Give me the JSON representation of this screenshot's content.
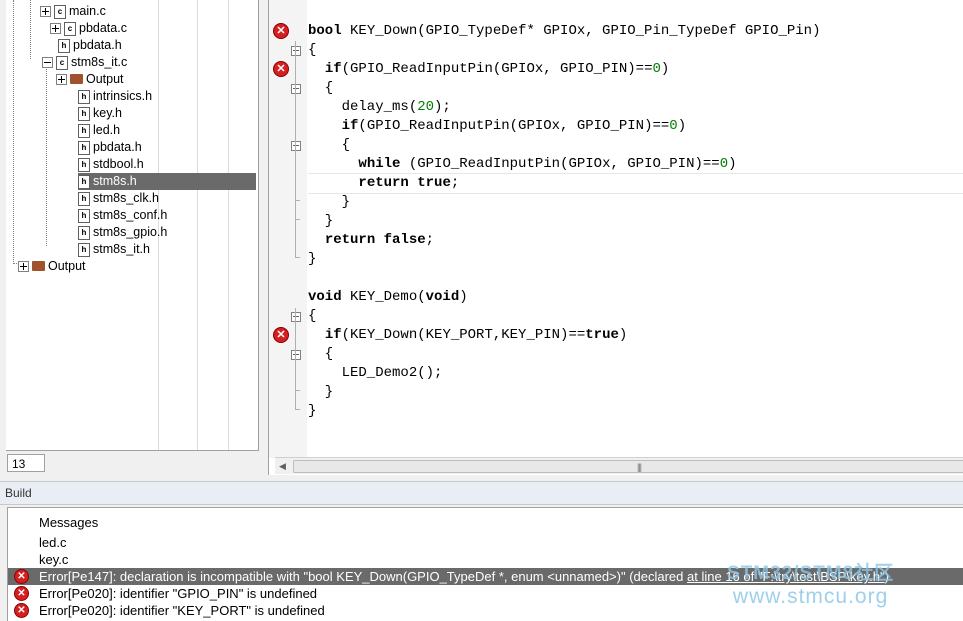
{
  "workspace": {
    "line_number": "13",
    "tree": [
      {
        "label": "main.c",
        "type": "c",
        "expander": "plus"
      },
      {
        "label": "pbdata.c",
        "type": "c",
        "expander": "plus"
      },
      {
        "label": "pbdata.h",
        "type": "h",
        "expander": ""
      },
      {
        "label": "stm8s_it.c",
        "type": "c",
        "expander": "minus"
      },
      {
        "label": "Output",
        "type": "folder",
        "expander": "plus"
      },
      {
        "label": "intrinsics.h",
        "type": "h",
        "expander": ""
      },
      {
        "label": "key.h",
        "type": "h",
        "expander": ""
      },
      {
        "label": "led.h",
        "type": "h",
        "expander": ""
      },
      {
        "label": "pbdata.h",
        "type": "h",
        "expander": ""
      },
      {
        "label": "stdbool.h",
        "type": "h",
        "expander": ""
      },
      {
        "label": "stm8s.h",
        "type": "h",
        "expander": "",
        "selected": true
      },
      {
        "label": "stm8s_clk.h",
        "type": "h",
        "expander": ""
      },
      {
        "label": "stm8s_conf.h",
        "type": "h",
        "expander": ""
      },
      {
        "label": "stm8s_gpio.h",
        "type": "h",
        "expander": ""
      },
      {
        "label": "stm8s_it.h",
        "type": "h",
        "expander": ""
      },
      {
        "label": "Output",
        "type": "folder",
        "expander": "plus"
      }
    ]
  },
  "editor": {
    "lines": [
      {
        "segments": [
          {
            "t": "bool",
            "c": "kw"
          },
          {
            "t": " KEY_Down(GPIO_TypeDef* GPIOx, GPIO_Pin_TypeDef GPIO_Pin)",
            "c": ""
          }
        ],
        "error": true
      },
      {
        "segments": [
          {
            "t": "{",
            "c": ""
          }
        ],
        "fold": "open"
      },
      {
        "segments": [
          {
            "t": "  ",
            "c": ""
          },
          {
            "t": "if",
            "c": "kw"
          },
          {
            "t": "(GPIO_ReadInputPin(GPIOx, GPIO_PIN)==",
            "c": ""
          },
          {
            "t": "0",
            "c": "num"
          },
          {
            "t": ")",
            "c": ""
          }
        ],
        "error": true
      },
      {
        "segments": [
          {
            "t": "  {",
            "c": ""
          }
        ],
        "fold": "open"
      },
      {
        "segments": [
          {
            "t": "    delay_ms(",
            "c": ""
          },
          {
            "t": "20",
            "c": "num"
          },
          {
            "t": ");",
            "c": ""
          }
        ]
      },
      {
        "segments": [
          {
            "t": "    ",
            "c": ""
          },
          {
            "t": "if",
            "c": "kw"
          },
          {
            "t": "(GPIO_ReadInputPin(GPIOx, GPIO_PIN)==",
            "c": ""
          },
          {
            "t": "0",
            "c": "num"
          },
          {
            "t": ")",
            "c": ""
          }
        ]
      },
      {
        "segments": [
          {
            "t": "    {",
            "c": ""
          }
        ],
        "fold": "open"
      },
      {
        "segments": [
          {
            "t": "      ",
            "c": ""
          },
          {
            "t": "while",
            "c": "kw"
          },
          {
            "t": " (GPIO_ReadInputPin(GPIOx, GPIO_PIN)==",
            "c": ""
          },
          {
            "t": "0",
            "c": "num"
          },
          {
            "t": ")",
            "c": ""
          }
        ]
      },
      {
        "segments": [
          {
            "t": "      ",
            "c": ""
          },
          {
            "t": "return",
            "c": "kw"
          },
          {
            "t": " ",
            "c": ""
          },
          {
            "t": "true",
            "c": "kw"
          },
          {
            "t": ";",
            "c": ""
          }
        ],
        "current": true
      },
      {
        "segments": [
          {
            "t": "    }",
            "c": ""
          }
        ]
      },
      {
        "segments": [
          {
            "t": "  }",
            "c": ""
          }
        ]
      },
      {
        "segments": [
          {
            "t": "  ",
            "c": ""
          },
          {
            "t": "return",
            "c": "kw"
          },
          {
            "t": " ",
            "c": ""
          },
          {
            "t": "false",
            "c": "kw"
          },
          {
            "t": ";",
            "c": ""
          }
        ]
      },
      {
        "segments": [
          {
            "t": "}",
            "c": ""
          }
        ]
      },
      {
        "segments": [
          {
            "t": "",
            "c": ""
          }
        ]
      },
      {
        "segments": [
          {
            "t": "void",
            "c": "kw"
          },
          {
            "t": " KEY_Demo(",
            "c": ""
          },
          {
            "t": "void",
            "c": "kw"
          },
          {
            "t": ")",
            "c": ""
          }
        ]
      },
      {
        "segments": [
          {
            "t": "{",
            "c": ""
          }
        ],
        "fold": "open"
      },
      {
        "segments": [
          {
            "t": "  ",
            "c": ""
          },
          {
            "t": "if",
            "c": "kw"
          },
          {
            "t": "(KEY_Down(KEY_PORT,KEY_PIN)==",
            "c": ""
          },
          {
            "t": "true",
            "c": "kw"
          },
          {
            "t": ")",
            "c": ""
          }
        ],
        "error": true
      },
      {
        "segments": [
          {
            "t": "  {",
            "c": ""
          }
        ],
        "fold": "open"
      },
      {
        "segments": [
          {
            "t": "    LED_Demo2();",
            "c": ""
          }
        ]
      },
      {
        "segments": [
          {
            "t": "  }",
            "c": ""
          }
        ]
      },
      {
        "segments": [
          {
            "t": "}",
            "c": ""
          }
        ]
      }
    ]
  },
  "build": {
    "title": "Build",
    "header": "Messages",
    "messages": [
      {
        "text": "led.c",
        "error": false
      },
      {
        "text": "key.c",
        "error": false
      },
      {
        "text": "Error[Pe147]: declaration is incompatible with \"bool KEY_Down(GPIO_TypeDef *, enum <unnamed>)\" (declared ",
        "link": "at line 16 of \"F:\\try\\test\\BSP\\key.h\"",
        "tail": ")",
        "error": true,
        "selected": true
      },
      {
        "text": "Error[Pe020]: identifier \"GPIO_PIN\" is undefined",
        "error": true
      },
      {
        "text": "Error[Pe020]: identifier \"KEY_PORT\" is undefined",
        "error": true
      }
    ]
  },
  "watermark": {
    "line1": "STM32/STM8社区",
    "line2": "www.stmcu.org"
  },
  "colors": {
    "error": "#d42020",
    "number": "#008000",
    "selection": "#6a6a6a",
    "watermark": "#8ec7e8"
  }
}
